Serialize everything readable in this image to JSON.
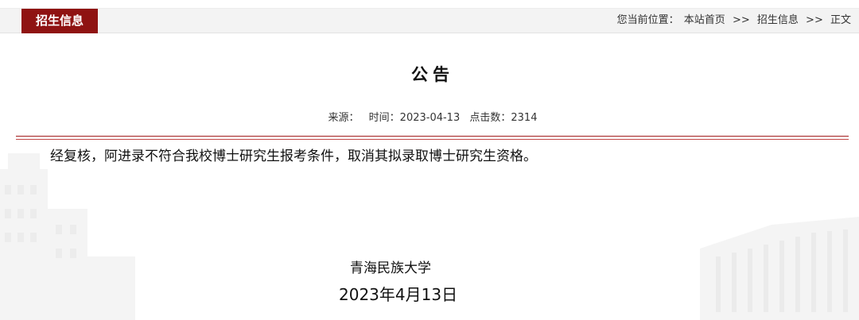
{
  "header": {
    "section_tab": "招生信息",
    "breadcrumb": {
      "prefix": "您当前位置：",
      "items": [
        "本站首页",
        "招生信息",
        "正文"
      ],
      "separator": ">>"
    }
  },
  "article": {
    "title": "公告",
    "meta": {
      "source_label": "来源：",
      "time_label": "时间：",
      "time_value": "2023-04-13",
      "clicks_label": "点击数：",
      "clicks_value": "2314"
    },
    "body": "经复核，阿进录不符合我校博士研究生报考条件，取消其拟录取博士研究生资格。",
    "signature": "青海民族大学",
    "date": "2023年4月13日"
  },
  "colors": {
    "brand": "#8f1312",
    "rule": "#a31d1d"
  }
}
